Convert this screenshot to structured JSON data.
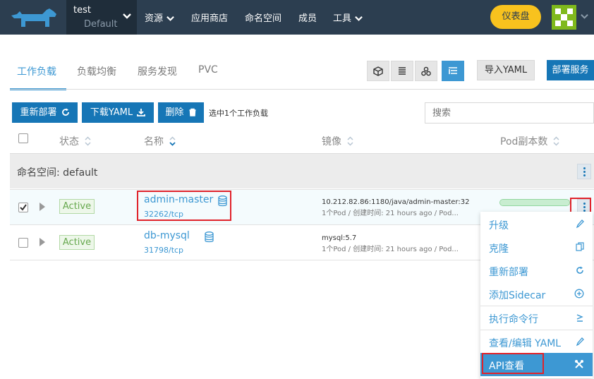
{
  "header": {
    "project_name": "test",
    "namespace": "Default",
    "nav": [
      "资源",
      "应用商店",
      "命名空间",
      "成员",
      "工具"
    ],
    "dashboard_label": "仪表盘"
  },
  "tabs": [
    "工作负载",
    "负载均衡",
    "服务发现",
    "PVC"
  ],
  "view_buttons": [
    "cube-icon",
    "list-icon",
    "nodes-icon",
    "tree-list-icon"
  ],
  "toolbar": {
    "import_yaml": "导入YAML",
    "deploy_service": "部署服务",
    "redeploy": "重新部署",
    "download_yaml": "下载YAML",
    "delete": "删除",
    "selection_text": "选中1个工作负载",
    "search_placeholder": "搜索"
  },
  "table": {
    "headers": [
      "状态",
      "名称",
      "镜像",
      "Pod副本数"
    ],
    "namespace_label": "命名空间: default",
    "rows": [
      {
        "status": "Active",
        "name": "admin-master",
        "port": "32262/tcp",
        "image": "10.212.82.86:1180/java/admin-master:32",
        "meta": "1个Pod / 创建时间: 21 hours ago / Pod...",
        "checked": true
      },
      {
        "status": "Active",
        "name": "db-mysql",
        "port": "31798/tcp",
        "image": "mysql:5.7",
        "meta": "1个Pod / 创建时间: 21 hours ago / Pod...",
        "checked": false
      }
    ]
  },
  "context_menu": {
    "items": [
      {
        "label": "升级",
        "icon": "pencil-icon"
      },
      {
        "label": "克隆",
        "icon": "clone-icon"
      },
      {
        "label": "重新部署",
        "icon": "refresh-icon"
      },
      {
        "label": "添加Sidecar",
        "icon": "plus-circle-icon"
      },
      {
        "label": "执行命令行",
        "icon": "terminal-icon"
      },
      {
        "label": "查看/编辑 YAML",
        "icon": "pencil-icon"
      },
      {
        "label": "API查看",
        "icon": "tools-icon"
      }
    ]
  },
  "colors": {
    "topbar": "#2c3e50",
    "accent": "#3d98d3",
    "primary_button": "#1676b6",
    "dashboard_button": "#f8c21e",
    "active_badge": "#66a84e",
    "highlight_box": "#e0232b"
  }
}
